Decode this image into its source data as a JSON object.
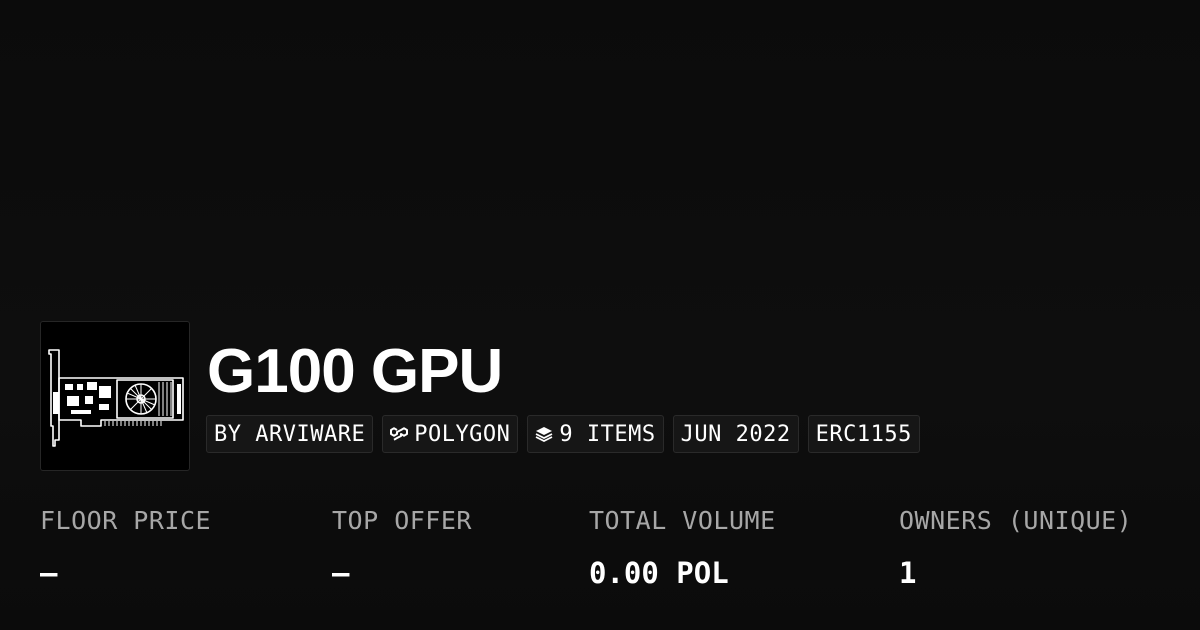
{
  "collection": {
    "title": "G100 GPU",
    "avatar_icon": "graphics-card-icon"
  },
  "badges": {
    "creator": "BY ARVIWARE",
    "chain": "POLYGON",
    "chain_icon": "polygon-icon",
    "items": "9 ITEMS",
    "items_icon": "layers-icon",
    "date": "JUN 2022",
    "standard": "ERC1155"
  },
  "stats": {
    "floor_price": {
      "label": "FLOOR PRICE",
      "value": "–"
    },
    "top_offer": {
      "label": "TOP OFFER",
      "value": "–"
    },
    "total_volume": {
      "label": "TOTAL VOLUME",
      "value": "0.00 POL"
    },
    "owners": {
      "label": "OWNERS (UNIQUE)",
      "value": "1"
    }
  },
  "colors": {
    "background": "#0b0b0b",
    "text": "#ffffff",
    "muted": "#a7a7a7",
    "badge_bg": "#161616"
  }
}
